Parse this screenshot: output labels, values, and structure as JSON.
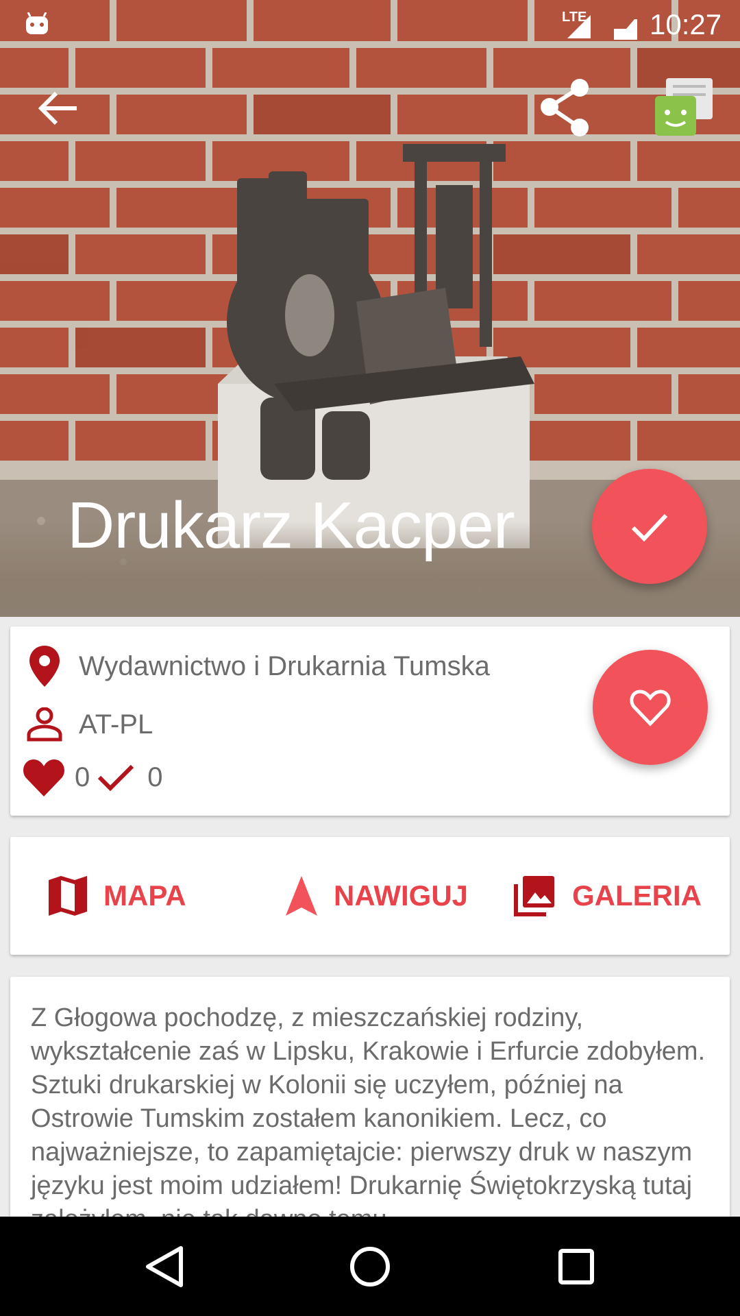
{
  "status_bar": {
    "network": "LTE",
    "time": "10:27"
  },
  "toolbar": {
    "back_icon": "arrow-left-icon",
    "share_icon": "share-icon",
    "badge_icon": "android-badge-icon"
  },
  "hero": {
    "title": "Drukarz Kacper",
    "fab_icon": "check-icon"
  },
  "info": {
    "place": "Wydawnictwo i Drukarnia Tumska",
    "author": "AT-PL",
    "likes": "0",
    "visits": "0",
    "fab_icon": "heart-outline-icon"
  },
  "actions": [
    {
      "label": "MAPA",
      "icon": "map-icon"
    },
    {
      "label": "NAWIGUJ",
      "icon": "navigation-icon"
    },
    {
      "label": "GALERIA",
      "icon": "gallery-icon"
    }
  ],
  "description": "Z Głogowa pochodzę, z mieszczańskiej rodziny, wykształcenie zaś w Lipsku, Krakowie i Erfurcie zdobyłem. Sztuki drukarskiej w Kolonii się uczyłem, później na Ostrowie Tumskim zostałem kanonikiem. Lecz, co najważniejsze, to zapamiętajcie: pierwszy druk w naszym języku jest moim udziałem! Drukarnię Świętokrzyską tutaj założyłem, nie tak dawno temu...",
  "colors": {
    "accent": "#f2525a",
    "icon_dark_red": "#b3141c",
    "label_red": "#e8424a",
    "text_gray": "#6b6b6b"
  }
}
